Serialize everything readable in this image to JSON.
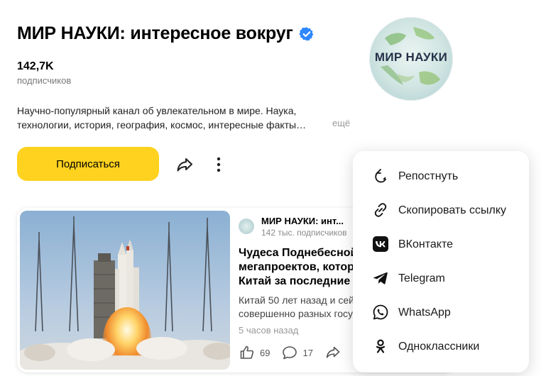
{
  "channel": {
    "name": "МИР НАУКИ: интересное вокруг",
    "subscribers_count": "142,7K",
    "subscribers_label": "подписчиков",
    "description": "Научно-популярный канал об увлекательном в мире. Наука, технологии, история, география, космос, интересные факты…",
    "more_label": "ещё",
    "avatar_text": "МИР НАУКИ",
    "subscribe_label": "Подписаться",
    "accent_color": "#ffd21f",
    "verified_color": "#2f87ff"
  },
  "post": {
    "channel_name": "МИР НАУКИ: инт...",
    "channel_subs": "142 тыс. подписчиков",
    "title": "Чудеса Поднебесной\nмегапроектов, котор\nКитай за последние 2",
    "excerpt": "Китай 50 лет назад и сей\nсовершенно разных госу",
    "time": "5 часов назад",
    "likes": "69",
    "comments": "17"
  },
  "share_menu": {
    "items": [
      {
        "label": "Репостнуть",
        "icon": "repost-icon"
      },
      {
        "label": "Скопировать ссылку",
        "icon": "link-icon"
      },
      {
        "label": "ВКонтакте",
        "icon": "vk-icon"
      },
      {
        "label": "Telegram",
        "icon": "telegram-icon"
      },
      {
        "label": "WhatsApp",
        "icon": "whatsapp-icon"
      },
      {
        "label": "Одноклассники",
        "icon": "odnoklassniki-icon"
      }
    ]
  }
}
